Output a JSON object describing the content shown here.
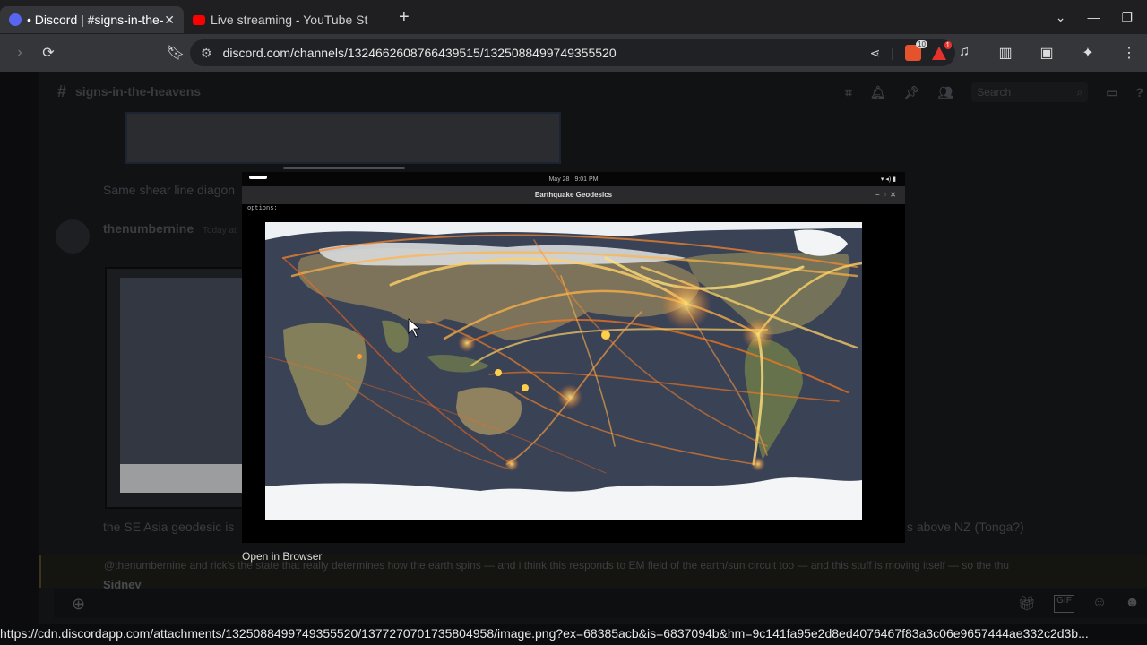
{
  "browser": {
    "tabs": [
      {
        "title": "• Discord | #signs-in-the-",
        "active": true
      },
      {
        "title": "Live streaming - YouTube St",
        "active": false
      }
    ],
    "new_tab_label": "+",
    "url": "discord.com/channels/1324662608766439515/1325088499749355520",
    "brave_badge": "10",
    "rewards_badge": "1"
  },
  "discord": {
    "channel_name": "signs-in-the-heavens",
    "search_placeholder": "Search",
    "message1_text": "Same shear line diagon",
    "author": "thenumbernine",
    "author_time": "Today at",
    "message2_text": "the SE Asia geodesic is",
    "message2_right_text": "s above NZ (Tonga?)",
    "reply_text": "@thenumbernine and rick's the state that really determines how the earth spins — and i think this responds to EM field of the earth/sun circuit too — and this stuff is moving itself — so the thu",
    "reply_author": "Sidney"
  },
  "viewer": {
    "top_date": "May 28",
    "top_time": "9:01 PM",
    "window_title": "Earthquake Geodesics",
    "options_label": "options:",
    "open_in_browser": "Open in Browser"
  },
  "status_url": "https://cdn.discordapp.com/attachments/1325088499749355520/1377270701735804958/image.png?ex=68385acb&is=6837094b&hm=9c141fa95e2d8ed4076467f83a3c06e9657444ae332c2d3b..."
}
